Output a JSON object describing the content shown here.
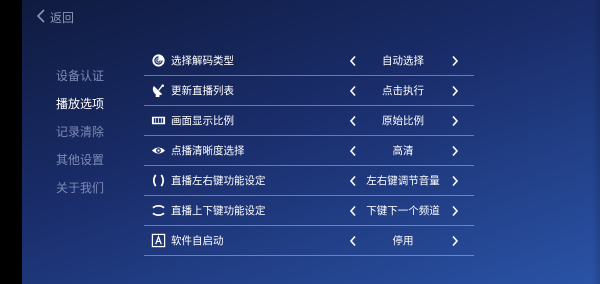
{
  "header": {
    "back_label": "返回"
  },
  "sidebar": {
    "items": [
      {
        "label": "设备认证"
      },
      {
        "label": "播放选项"
      },
      {
        "label": "记录清除"
      },
      {
        "label": "其他设置"
      },
      {
        "label": "关于我们"
      }
    ],
    "active_index": 1
  },
  "settings": [
    {
      "icon": "spiral-icon",
      "label": "选择解码类型",
      "value": "自动选择"
    },
    {
      "icon": "satellite-icon",
      "label": "更新直播列表",
      "value": "点击执行"
    },
    {
      "icon": "aspect-ratio-icon",
      "label": "画面显示比例",
      "value": "原始比例"
    },
    {
      "icon": "eye-icon",
      "label": "点播清晰度选择",
      "value": "高清"
    },
    {
      "icon": "left-right-arrows-icon",
      "label": "直播左右键功能设定",
      "value": "左右键调节音量"
    },
    {
      "icon": "up-down-arrows-icon",
      "label": "直播上下键功能设定",
      "value": "下键下一个频道"
    },
    {
      "icon": "auto-start-icon",
      "label": "软件自启动",
      "value": "停用"
    }
  ],
  "colors": {
    "accent": "#ffffff",
    "inactive": "#7d8ab5",
    "divider": "#aab9e6"
  }
}
